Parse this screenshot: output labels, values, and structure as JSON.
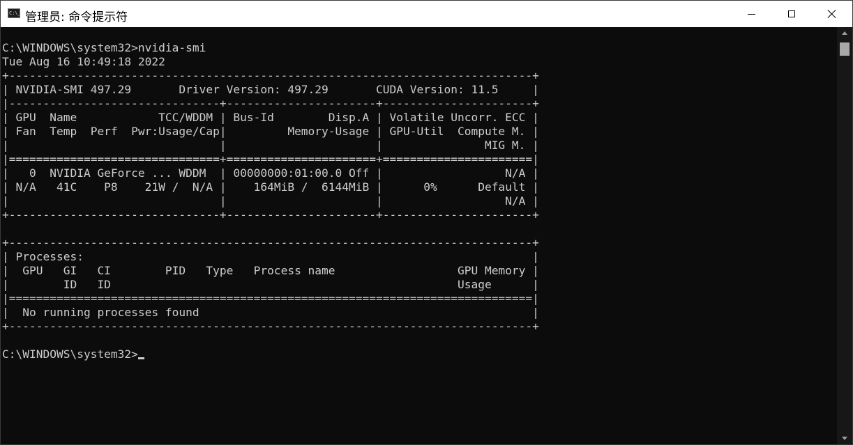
{
  "window": {
    "title": "管理员: 命令提示符",
    "icon": "cmd-icon",
    "icon_text": "C:\\_"
  },
  "controls": {
    "minimize": "minimize-icon",
    "maximize": "maximize-icon",
    "close": "close-icon"
  },
  "console": {
    "lines": [
      "C:\\WINDOWS\\system32>nvidia-smi",
      "Tue Aug 16 10:49:18 2022",
      "+-----------------------------------------------------------------------------+",
      "| NVIDIA-SMI 497.29       Driver Version: 497.29       CUDA Version: 11.5     |",
      "|-------------------------------+----------------------+----------------------+",
      "| GPU  Name            TCC/WDDM | Bus-Id        Disp.A | Volatile Uncorr. ECC |",
      "| Fan  Temp  Perf  Pwr:Usage/Cap|         Memory-Usage | GPU-Util  Compute M. |",
      "|                               |                      |               MIG M. |",
      "|===============================+======================+======================|",
      "|   0  NVIDIA GeForce ... WDDM  | 00000000:01:00.0 Off |                  N/A |",
      "| N/A   41C    P8    21W /  N/A |    164MiB /  6144MiB |      0%      Default |",
      "|                               |                      |                  N/A |",
      "+-------------------------------+----------------------+----------------------+",
      "",
      "+-----------------------------------------------------------------------------+",
      "| Processes:                                                                  |",
      "|  GPU   GI   CI        PID   Type   Process name                  GPU Memory |",
      "|        ID   ID                                                   Usage      |",
      "|=============================================================================|",
      "|  No running processes found                                                 |",
      "+-----------------------------------------------------------------------------+",
      "",
      "C:\\WINDOWS\\system32>"
    ]
  },
  "colors": {
    "background": "#0c0c0c",
    "text": "#cccccc",
    "titlebar": "#ffffff"
  }
}
